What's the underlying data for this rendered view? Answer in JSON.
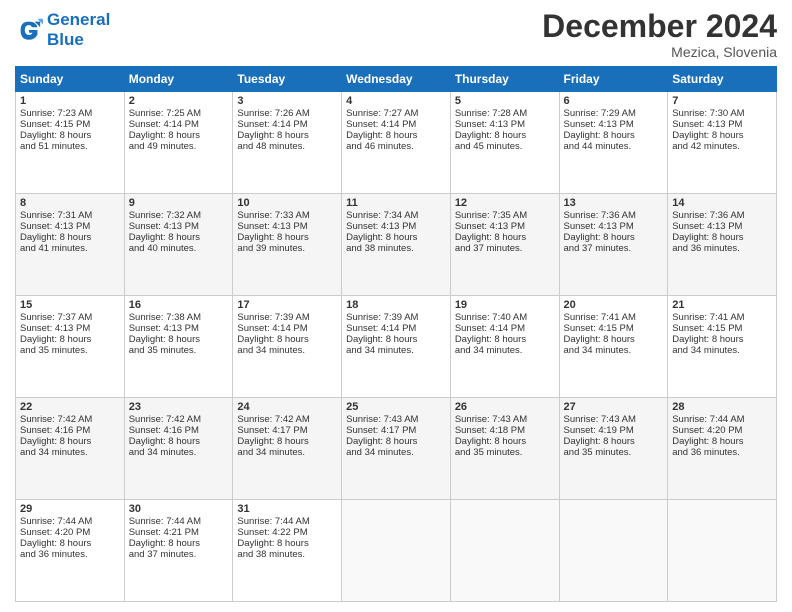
{
  "header": {
    "logo_line1": "General",
    "logo_line2": "Blue",
    "month": "December 2024",
    "location": "Mezica, Slovenia"
  },
  "weekdays": [
    "Sunday",
    "Monday",
    "Tuesday",
    "Wednesday",
    "Thursday",
    "Friday",
    "Saturday"
  ],
  "weeks": [
    [
      {
        "day": "1",
        "lines": [
          "Sunrise: 7:23 AM",
          "Sunset: 4:15 PM",
          "Daylight: 8 hours",
          "and 51 minutes."
        ]
      },
      {
        "day": "2",
        "lines": [
          "Sunrise: 7:25 AM",
          "Sunset: 4:14 PM",
          "Daylight: 8 hours",
          "and 49 minutes."
        ]
      },
      {
        "day": "3",
        "lines": [
          "Sunrise: 7:26 AM",
          "Sunset: 4:14 PM",
          "Daylight: 8 hours",
          "and 48 minutes."
        ]
      },
      {
        "day": "4",
        "lines": [
          "Sunrise: 7:27 AM",
          "Sunset: 4:14 PM",
          "Daylight: 8 hours",
          "and 46 minutes."
        ]
      },
      {
        "day": "5",
        "lines": [
          "Sunrise: 7:28 AM",
          "Sunset: 4:13 PM",
          "Daylight: 8 hours",
          "and 45 minutes."
        ]
      },
      {
        "day": "6",
        "lines": [
          "Sunrise: 7:29 AM",
          "Sunset: 4:13 PM",
          "Daylight: 8 hours",
          "and 44 minutes."
        ]
      },
      {
        "day": "7",
        "lines": [
          "Sunrise: 7:30 AM",
          "Sunset: 4:13 PM",
          "Daylight: 8 hours",
          "and 42 minutes."
        ]
      }
    ],
    [
      {
        "day": "8",
        "lines": [
          "Sunrise: 7:31 AM",
          "Sunset: 4:13 PM",
          "Daylight: 8 hours",
          "and 41 minutes."
        ]
      },
      {
        "day": "9",
        "lines": [
          "Sunrise: 7:32 AM",
          "Sunset: 4:13 PM",
          "Daylight: 8 hours",
          "and 40 minutes."
        ]
      },
      {
        "day": "10",
        "lines": [
          "Sunrise: 7:33 AM",
          "Sunset: 4:13 PM",
          "Daylight: 8 hours",
          "and 39 minutes."
        ]
      },
      {
        "day": "11",
        "lines": [
          "Sunrise: 7:34 AM",
          "Sunset: 4:13 PM",
          "Daylight: 8 hours",
          "and 38 minutes."
        ]
      },
      {
        "day": "12",
        "lines": [
          "Sunrise: 7:35 AM",
          "Sunset: 4:13 PM",
          "Daylight: 8 hours",
          "and 37 minutes."
        ]
      },
      {
        "day": "13",
        "lines": [
          "Sunrise: 7:36 AM",
          "Sunset: 4:13 PM",
          "Daylight: 8 hours",
          "and 37 minutes."
        ]
      },
      {
        "day": "14",
        "lines": [
          "Sunrise: 7:36 AM",
          "Sunset: 4:13 PM",
          "Daylight: 8 hours",
          "and 36 minutes."
        ]
      }
    ],
    [
      {
        "day": "15",
        "lines": [
          "Sunrise: 7:37 AM",
          "Sunset: 4:13 PM",
          "Daylight: 8 hours",
          "and 35 minutes."
        ]
      },
      {
        "day": "16",
        "lines": [
          "Sunrise: 7:38 AM",
          "Sunset: 4:13 PM",
          "Daylight: 8 hours",
          "and 35 minutes."
        ]
      },
      {
        "day": "17",
        "lines": [
          "Sunrise: 7:39 AM",
          "Sunset: 4:14 PM",
          "Daylight: 8 hours",
          "and 34 minutes."
        ]
      },
      {
        "day": "18",
        "lines": [
          "Sunrise: 7:39 AM",
          "Sunset: 4:14 PM",
          "Daylight: 8 hours",
          "and 34 minutes."
        ]
      },
      {
        "day": "19",
        "lines": [
          "Sunrise: 7:40 AM",
          "Sunset: 4:14 PM",
          "Daylight: 8 hours",
          "and 34 minutes."
        ]
      },
      {
        "day": "20",
        "lines": [
          "Sunrise: 7:41 AM",
          "Sunset: 4:15 PM",
          "Daylight: 8 hours",
          "and 34 minutes."
        ]
      },
      {
        "day": "21",
        "lines": [
          "Sunrise: 7:41 AM",
          "Sunset: 4:15 PM",
          "Daylight: 8 hours",
          "and 34 minutes."
        ]
      }
    ],
    [
      {
        "day": "22",
        "lines": [
          "Sunrise: 7:42 AM",
          "Sunset: 4:16 PM",
          "Daylight: 8 hours",
          "and 34 minutes."
        ]
      },
      {
        "day": "23",
        "lines": [
          "Sunrise: 7:42 AM",
          "Sunset: 4:16 PM",
          "Daylight: 8 hours",
          "and 34 minutes."
        ]
      },
      {
        "day": "24",
        "lines": [
          "Sunrise: 7:42 AM",
          "Sunset: 4:17 PM",
          "Daylight: 8 hours",
          "and 34 minutes."
        ]
      },
      {
        "day": "25",
        "lines": [
          "Sunrise: 7:43 AM",
          "Sunset: 4:17 PM",
          "Daylight: 8 hours",
          "and 34 minutes."
        ]
      },
      {
        "day": "26",
        "lines": [
          "Sunrise: 7:43 AM",
          "Sunset: 4:18 PM",
          "Daylight: 8 hours",
          "and 35 minutes."
        ]
      },
      {
        "day": "27",
        "lines": [
          "Sunrise: 7:43 AM",
          "Sunset: 4:19 PM",
          "Daylight: 8 hours",
          "and 35 minutes."
        ]
      },
      {
        "day": "28",
        "lines": [
          "Sunrise: 7:44 AM",
          "Sunset: 4:20 PM",
          "Daylight: 8 hours",
          "and 36 minutes."
        ]
      }
    ],
    [
      {
        "day": "29",
        "lines": [
          "Sunrise: 7:44 AM",
          "Sunset: 4:20 PM",
          "Daylight: 8 hours",
          "and 36 minutes."
        ]
      },
      {
        "day": "30",
        "lines": [
          "Sunrise: 7:44 AM",
          "Sunset: 4:21 PM",
          "Daylight: 8 hours",
          "and 37 minutes."
        ]
      },
      {
        "day": "31",
        "lines": [
          "Sunrise: 7:44 AM",
          "Sunset: 4:22 PM",
          "Daylight: 8 hours",
          "and 38 minutes."
        ]
      },
      null,
      null,
      null,
      null
    ]
  ]
}
